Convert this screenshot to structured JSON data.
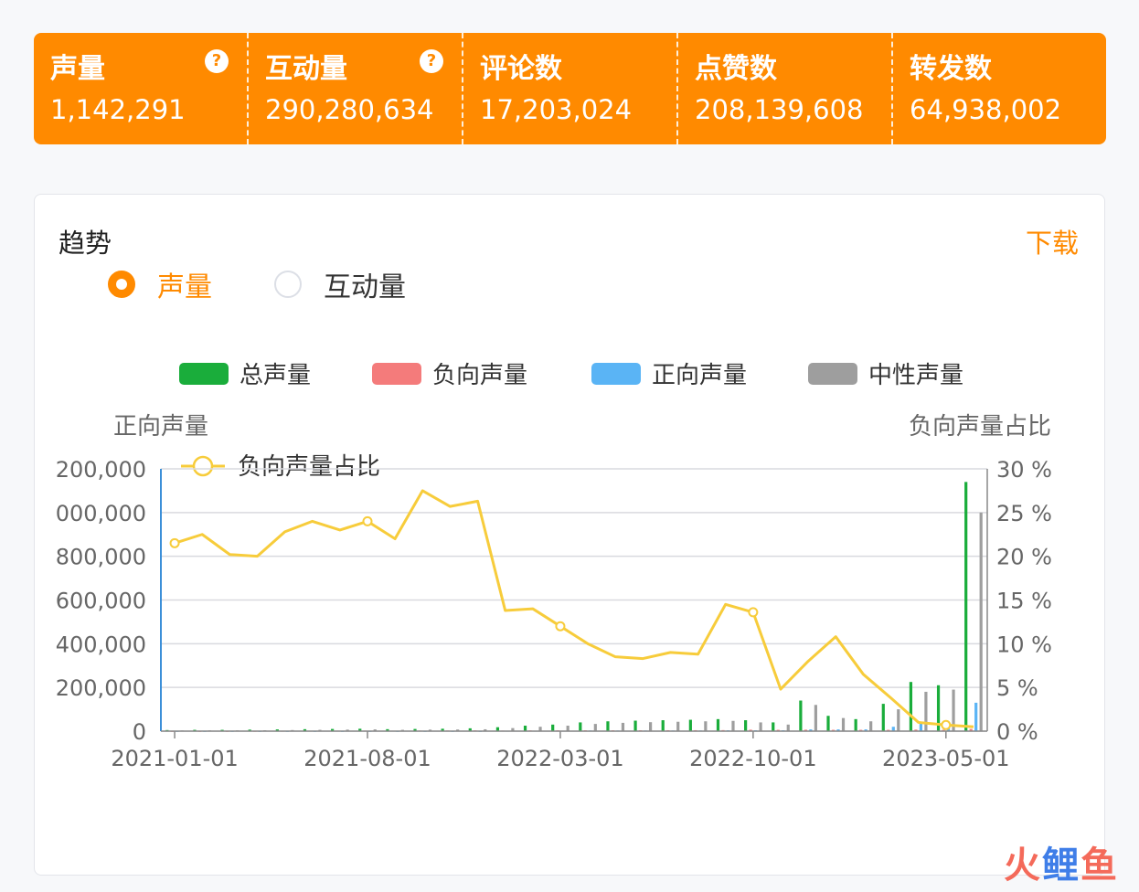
{
  "stats": [
    {
      "label": "声量",
      "value": "1,142,291",
      "help": "?"
    },
    {
      "label": "互动量",
      "value": "290,280,634",
      "help": "?"
    },
    {
      "label": "评论数",
      "value": "17,203,024"
    },
    {
      "label": "点赞数",
      "value": "208,139,608"
    },
    {
      "label": "转发数",
      "value": "64,938,002"
    }
  ],
  "card": {
    "title": "趋势",
    "download": "下载",
    "radios": [
      {
        "label": "声量",
        "selected": true
      },
      {
        "label": "互动量",
        "selected": false
      }
    ]
  },
  "watermark": {
    "c1": "火",
    "c2": "鲤",
    "c3": "鱼"
  },
  "chart_data": {
    "type": "bar",
    "left_axis_title": "正向声量",
    "right_axis_title": "负向声量占比",
    "y_left_ticks": [
      "0",
      "200,000",
      "400,000",
      "600,000",
      "800,000",
      "000,000",
      "200,000"
    ],
    "y_right_ticks": [
      "0 %",
      "5 %",
      "10 %",
      "15 %",
      "20 %",
      "25 %",
      "30 %"
    ],
    "ylim_left": [
      0,
      1200000
    ],
    "ylim_right": [
      0,
      30
    ],
    "x_tick_labels": [
      "2021-01-01",
      "2021-08-01",
      "2022-03-01",
      "2022-10-01",
      "2023-05-01"
    ],
    "categories": [
      "2021-01",
      "2021-02",
      "2021-03",
      "2021-04",
      "2021-05",
      "2021-06",
      "2021-07",
      "2021-08",
      "2021-09",
      "2021-10",
      "2021-11",
      "2021-12",
      "2022-01",
      "2022-02",
      "2022-03",
      "2022-04",
      "2022-05",
      "2022-06",
      "2022-07",
      "2022-08",
      "2022-09",
      "2022-10",
      "2022-11",
      "2022-12",
      "2023-01",
      "2023-02",
      "2023-03",
      "2023-04",
      "2023-05",
      "2023-06"
    ],
    "series": [
      {
        "name": "总声量",
        "kind": "bar",
        "color": "#1aad3b",
        "values": [
          5000,
          6000,
          6000,
          7000,
          8000,
          9000,
          10000,
          11000,
          9000,
          10000,
          11000,
          13000,
          18000,
          25000,
          30000,
          40000,
          45000,
          48000,
          50000,
          52000,
          55000,
          50000,
          40000,
          140000,
          70000,
          55000,
          125000,
          225000,
          210000,
          1140000
        ]
      },
      {
        "name": "负向声量",
        "kind": "bar",
        "color": "#f47b7b",
        "values": [
          1000,
          1200,
          1200,
          1400,
          1700,
          2000,
          2300,
          2400,
          2100,
          2600,
          2900,
          3400,
          2500,
          3400,
          3700,
          4000,
          3800,
          4000,
          4200,
          4400,
          4700,
          6500,
          6000,
          6500,
          6000,
          6000,
          6000,
          7000,
          6000,
          10000
        ]
      },
      {
        "name": "正向声量",
        "kind": "bar",
        "color": "#5ab4f5",
        "values": [
          1000,
          1000,
          1000,
          1000,
          1000,
          1000,
          1000,
          1000,
          1000,
          1000,
          1000,
          1000,
          2000,
          2000,
          2000,
          3000,
          3000,
          3000,
          3000,
          3000,
          4000,
          4000,
          4000,
          8000,
          8000,
          8000,
          20000,
          40000,
          25000,
          130000
        ]
      },
      {
        "name": "中性声量",
        "kind": "bar",
        "color": "#9e9e9e",
        "values": [
          3000,
          3500,
          3500,
          4000,
          5000,
          6000,
          7000,
          8000,
          6000,
          7000,
          7500,
          8500,
          14000,
          20000,
          25000,
          33000,
          38000,
          41000,
          43000,
          45000,
          47000,
          40000,
          30000,
          120000,
          60000,
          45000,
          100000,
          180000,
          190000,
          1000000
        ]
      },
      {
        "name": "负向声量占比",
        "kind": "line",
        "color": "#f7cc3b",
        "axis": "right",
        "values": [
          21.5,
          22.5,
          20.2,
          20.0,
          22.8,
          24.0,
          23.0,
          24.0,
          22.0,
          27.5,
          25.7,
          26.3,
          13.8,
          14.0,
          12.0,
          10.0,
          8.5,
          8.3,
          9.0,
          8.8,
          14.5,
          13.6,
          4.8,
          8.0,
          10.8,
          6.5,
          3.8,
          1.0,
          0.7,
          0.5
        ]
      }
    ],
    "legend_position": "top",
    "grid": true
  }
}
